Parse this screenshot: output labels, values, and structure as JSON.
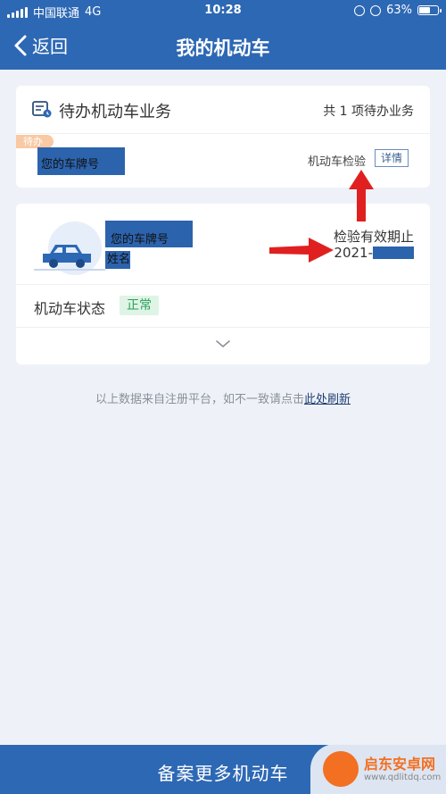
{
  "status_bar": {
    "carrier": "中国联通",
    "network": "4G",
    "time": "10:28",
    "battery": "63%",
    "battery_level": 0.63
  },
  "nav": {
    "back_label": "返回",
    "title": "我的机动车"
  },
  "todo_card": {
    "title": "待办机动车业务",
    "count_text": "共 1 项待办业务",
    "tag": "待办",
    "plate_placeholder": "您的车牌号",
    "business": "机动车检验",
    "detail_label": "详情"
  },
  "vehicle_card": {
    "plate_placeholder": "您的车牌号",
    "owner_placeholder": "姓名",
    "valid_label": "检验有效期止",
    "valid_date_prefix": "2021-",
    "status_label": "机动车状态",
    "status_value": "正常"
  },
  "notice": {
    "text": "以上数据来自注册平台，如不一致请点击",
    "link": "此处刷新"
  },
  "bottom": {
    "register_label": "备案更多机动车"
  },
  "watermark": {
    "name": "启东安卓网",
    "url": "www.qdlitdq.com"
  },
  "colors": {
    "primary": "#2d68b4",
    "annotation_arrow": "#e02020",
    "status_ok": "#2aa05a"
  }
}
